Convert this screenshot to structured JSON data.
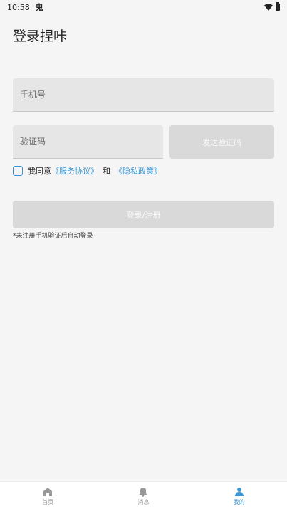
{
  "status_bar": {
    "time": "10:58",
    "app_icon_text": "鬼"
  },
  "page_title": "登录捏咔",
  "phone_field": {
    "placeholder": "手机号",
    "value": ""
  },
  "code_field": {
    "placeholder": "验证码",
    "value": ""
  },
  "send_code_button": "发送验证码",
  "agreement": {
    "checked": false,
    "prefix": "我同意",
    "service_link": "《服务协议》",
    "and": "和",
    "privacy_link": "《隐私政策》"
  },
  "login_button": "登录/注册",
  "hint": "*未注册手机验证后自动登录",
  "bottom_nav": {
    "items": [
      {
        "label": "首页",
        "icon": "home-icon",
        "active": false
      },
      {
        "label": "消息",
        "icon": "bell-icon",
        "active": false
      },
      {
        "label": "我的",
        "icon": "user-icon",
        "active": true
      }
    ]
  },
  "colors": {
    "accent": "#3a9ad8",
    "disabled_button": "#d9d9d9",
    "field_bg": "#e6e6e6",
    "page_bg": "#f5f5f5"
  }
}
